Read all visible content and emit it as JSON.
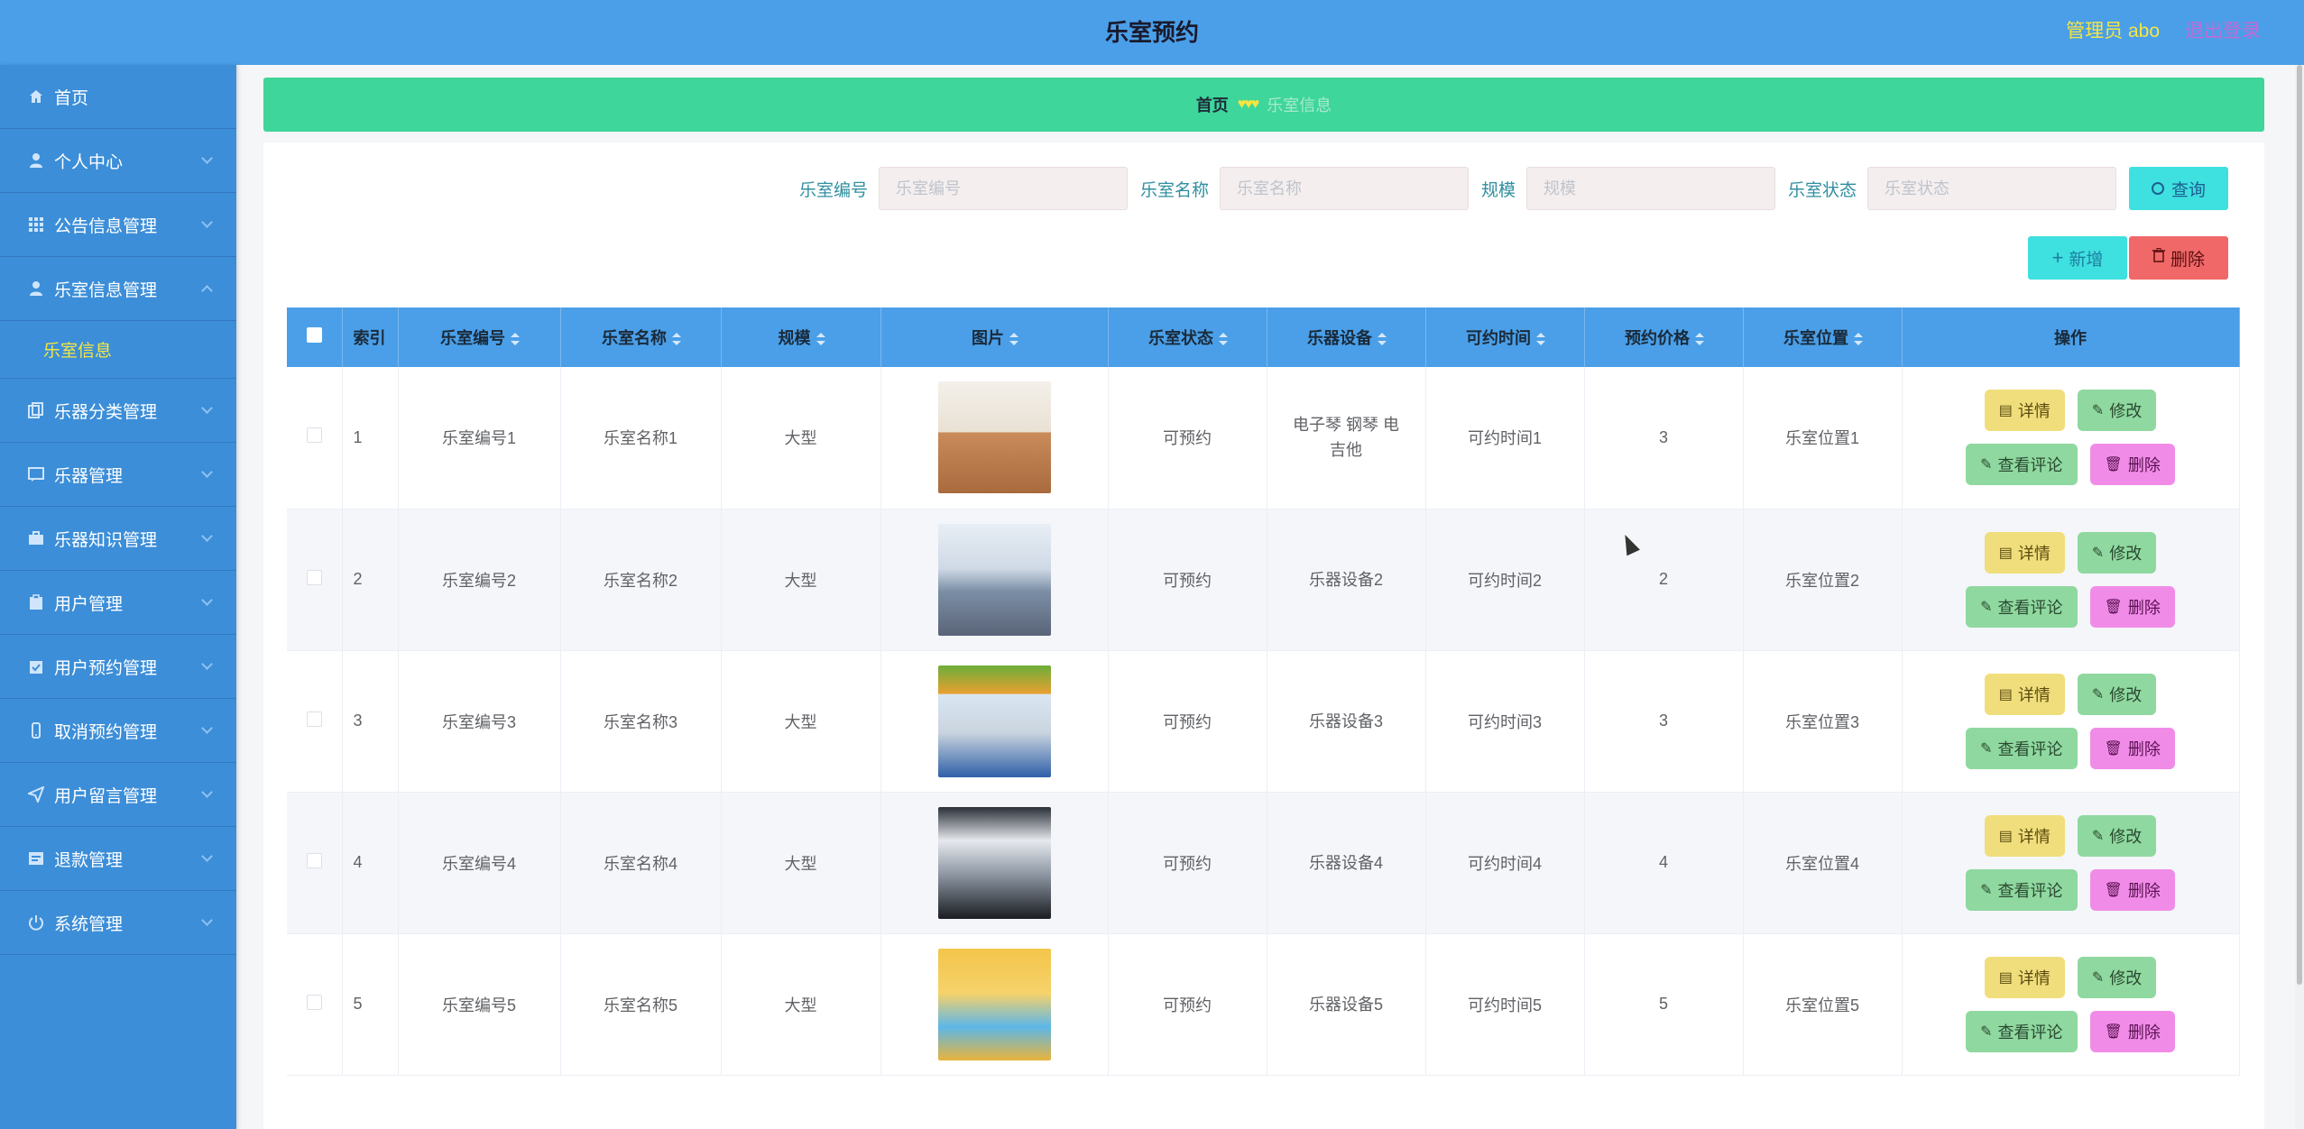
{
  "header": {
    "title": "乐室预约",
    "user": "管理员 abo",
    "logout": "退出登录"
  },
  "sidebar": {
    "items": [
      {
        "label": "首页",
        "icon": "home-icon"
      },
      {
        "label": "个人中心",
        "icon": "user-icon"
      },
      {
        "label": "公告信息管理",
        "icon": "grid-icon"
      },
      {
        "label": "乐室信息管理",
        "icon": "user-icon",
        "expanded": true
      },
      {
        "label": "乐器分类管理",
        "icon": "copy-icon"
      },
      {
        "label": "乐器管理",
        "icon": "message-icon"
      },
      {
        "label": "乐器知识管理",
        "icon": "briefcase-icon"
      },
      {
        "label": "用户管理",
        "icon": "clipboard-icon"
      },
      {
        "label": "用户预约管理",
        "icon": "clipboard-check-icon"
      },
      {
        "label": "取消预约管理",
        "icon": "phone-icon"
      },
      {
        "label": "用户留言管理",
        "icon": "send-icon"
      },
      {
        "label": "退款管理",
        "icon": "receipt-icon"
      },
      {
        "label": "系统管理",
        "icon": "power-icon"
      }
    ],
    "submenu": "乐室信息"
  },
  "breadcrumb": {
    "home": "首页",
    "separator": "♥♥♥",
    "current": "乐室信息"
  },
  "search": {
    "fields": [
      {
        "label": "乐室编号",
        "placeholder": "乐室编号"
      },
      {
        "label": "乐室名称",
        "placeholder": "乐室名称"
      },
      {
        "label": "规模",
        "placeholder": "规模"
      },
      {
        "label": "乐室状态",
        "placeholder": "乐室状态"
      }
    ],
    "query_label": "查询"
  },
  "actions": {
    "add_label": "新增",
    "delete_label": "删除"
  },
  "table": {
    "columns": [
      "索引",
      "乐室编号",
      "乐室名称",
      "规模",
      "图片",
      "乐室状态",
      "乐器设备",
      "可约时间",
      "预约价格",
      "乐室位置",
      "操作"
    ],
    "rows": [
      {
        "index": "1",
        "code": "乐室编号1",
        "name": "乐室名称1",
        "scale": "大型",
        "status": "可预约",
        "equipment": "电子琴 钢琴 电吉他",
        "time": "可约时间1",
        "price": "3",
        "location": "乐室位置1"
      },
      {
        "index": "2",
        "code": "乐室编号2",
        "name": "乐室名称2",
        "scale": "大型",
        "status": "可预约",
        "equipment": "乐器设备2",
        "time": "可约时间2",
        "price": "2",
        "location": "乐室位置2"
      },
      {
        "index": "3",
        "code": "乐室编号3",
        "name": "乐室名称3",
        "scale": "大型",
        "status": "可预约",
        "equipment": "乐器设备3",
        "time": "可约时间3",
        "price": "3",
        "location": "乐室位置3"
      },
      {
        "index": "4",
        "code": "乐室编号4",
        "name": "乐室名称4",
        "scale": "大型",
        "status": "可预约",
        "equipment": "乐器设备4",
        "time": "可约时间4",
        "price": "4",
        "location": "乐室位置4"
      },
      {
        "index": "5",
        "code": "乐室编号5",
        "name": "乐室名称5",
        "scale": "大型",
        "status": "可预约",
        "equipment": "乐器设备5",
        "time": "可约时间5",
        "price": "5",
        "location": "乐室位置5"
      }
    ],
    "ops": {
      "detail": "详情",
      "edit": "修改",
      "review": "查看评论",
      "delete": "删除"
    }
  },
  "colors": {
    "header": "#4a9fe8",
    "sidebar": "#3c8ed8",
    "breadcrumb": "#3ed69a",
    "accent_yellow": "#f5e642"
  }
}
